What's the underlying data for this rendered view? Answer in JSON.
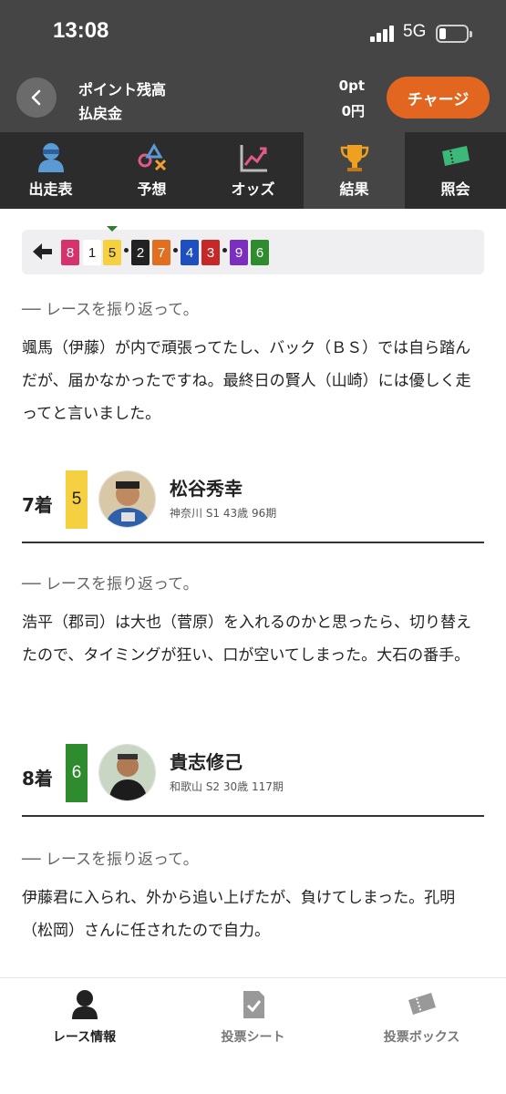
{
  "status": {
    "time": "13:08",
    "network": "5G"
  },
  "header": {
    "points_label": "ポイント残高",
    "refund_label": "払戻金",
    "points_value": "0pt",
    "refund_value": "0円",
    "charge_label": "チャージ"
  },
  "tabs": [
    {
      "label": "出走表",
      "icon": "racer-icon"
    },
    {
      "label": "予想",
      "icon": "prediction-icon"
    },
    {
      "label": "オッズ",
      "icon": "odds-chart-icon"
    },
    {
      "label": "結果",
      "icon": "trophy-icon",
      "active": true
    },
    {
      "label": "照会",
      "icon": "ticket-icon"
    }
  ],
  "result_strip": {
    "numbers": [
      "8",
      "1",
      "5",
      "2",
      "7",
      "4",
      "3",
      "9",
      "6"
    ],
    "colors": {
      "8": "#d6336c",
      "1": "#ffffff",
      "5": "#f5d142",
      "2": "#222222",
      "7": "#e07020",
      "4": "#1f4fbf",
      "3": "#c62828",
      "9": "#7b2fbf",
      "6": "#2e8b2e"
    }
  },
  "review_first": {
    "heading": "── レースを振り返って。",
    "body": "颯馬（伊藤）が内で頑張ってたし、バック（ＢＳ）では自ら踏んだが、届かなかったですね。最終日の賢人（山崎）には優しく走ってと言いました。"
  },
  "racers": [
    {
      "rank": "7着",
      "car": "5",
      "car_color": "#f5d142",
      "name": "松谷秀幸",
      "info": "神奈川 S1 43歳 96期",
      "review_heading": "── レースを振り返って。",
      "review_body": "浩平（郡司）は大也（菅原）を入れるのかと思ったら、切り替えたので、タイミングが狂い、口が空いてしまった。大石の番手。"
    },
    {
      "rank": "8着",
      "car": "6",
      "car_color": "#2e8b2e",
      "name": "貴志修己",
      "info": "和歌山 S2 30歳 117期",
      "review_heading": "── レースを振り返って。",
      "review_body": "伊藤君に入られ、外から追い上げたが、負けてしまった。孔明（松岡）さんに任されたので自力。"
    }
  ],
  "bottom_nav": [
    {
      "label": "レース情報",
      "icon": "race-info-icon",
      "active": true
    },
    {
      "label": "投票シート",
      "icon": "vote-sheet-icon"
    },
    {
      "label": "投票ボックス",
      "icon": "vote-box-icon"
    }
  ]
}
